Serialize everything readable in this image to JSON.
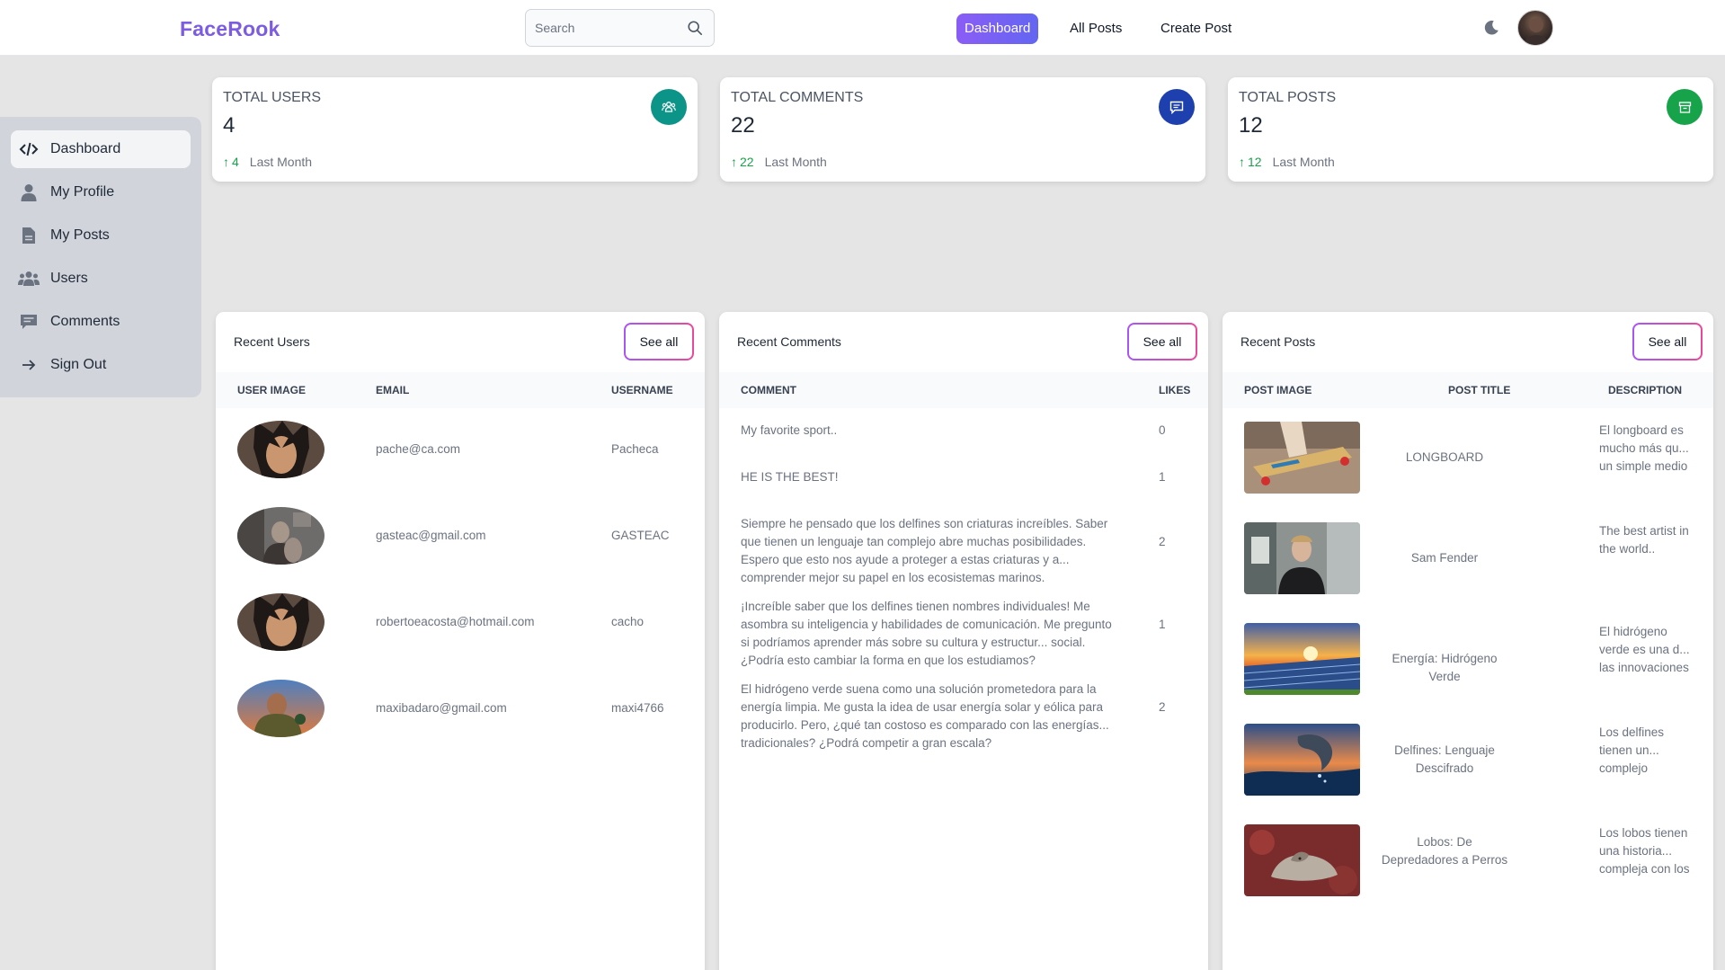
{
  "navbar": {
    "brand": "FaceRook",
    "search_placeholder": "Search",
    "links": [
      "Dashboard",
      "All Posts",
      "Create Post"
    ]
  },
  "sidebar": {
    "items": [
      {
        "label": "Dashboard",
        "icon": "code-icon",
        "active": true
      },
      {
        "label": "My Profile",
        "icon": "user-icon"
      },
      {
        "label": "My Posts",
        "icon": "document-icon"
      },
      {
        "label": "Users",
        "icon": "users-icon"
      },
      {
        "label": "Comments",
        "icon": "comment-icon"
      },
      {
        "label": "Sign Out",
        "icon": "arrow-right-icon"
      }
    ]
  },
  "stats": [
    {
      "title": "TOTAL USERS",
      "value": "4",
      "delta": "4",
      "period": "Last Month",
      "color": "#0d9488",
      "icon": "users-group-icon"
    },
    {
      "title": "TOTAL COMMENTS",
      "value": "22",
      "delta": "22",
      "period": "Last Month",
      "color": "#1e40af",
      "icon": "comment-icon"
    },
    {
      "title": "TOTAL POSTS",
      "value": "12",
      "delta": "12",
      "period": "Last Month",
      "color": "#16a34a",
      "icon": "archive-icon"
    }
  ],
  "recent_users": {
    "title": "Recent Users",
    "see_all": "See all",
    "headers": [
      "USER IMAGE",
      "EMAIL",
      "USERNAME"
    ],
    "rows": [
      {
        "email": "pache@ca.com",
        "username": "Pacheca"
      },
      {
        "email": "gasteac@gmail.com",
        "username": "GASTEAC"
      },
      {
        "email": "robertoeacosta@hotmail.com",
        "username": "cacho"
      },
      {
        "email": "maxibadaro@gmail.com",
        "username": "maxi4766"
      }
    ]
  },
  "recent_comments": {
    "title": "Recent Comments",
    "see_all": "See all",
    "headers": [
      "COMMENT",
      "LIKES"
    ],
    "rows": [
      {
        "comment": "My favorite sport..",
        "likes": "0"
      },
      {
        "comment": "HE IS THE BEST!",
        "likes": "1"
      },
      {
        "comment": "Siempre he pensado que los delfines son criaturas increíbles. Saber que tienen un lenguaje tan complejo abre muchas posibilidades. Espero que esto nos ayude a proteger a estas criaturas y a... comprender mejor su papel en los ecosistemas marinos.",
        "likes": "2"
      },
      {
        "comment": "¡Increíble saber que los delfines tienen nombres individuales! Me asombra su inteligencia y habilidades de comunicación. Me pregunto si podríamos aprender más sobre su cultura y estructur... social. ¿Podría esto cambiar la forma en que los estudiamos?",
        "likes": "1"
      },
      {
        "comment": "El hidrógeno verde suena como una solución prometedora para la energía limpia. Me gusta la idea de usar energía solar y eólica para producirlo. Pero, ¿qué tan costoso es comparado con las energías... tradicionales? ¿Podrá competir a gran escala?",
        "likes": "2"
      }
    ]
  },
  "recent_posts": {
    "title": "Recent Posts",
    "see_all": "See all",
    "headers": [
      "POST IMAGE",
      "POST TITLE",
      "DESCRIPTION"
    ],
    "rows": [
      {
        "title": "LONGBOARD",
        "description": "El longboard es mucho más qu... un simple medio"
      },
      {
        "title": "Sam Fender",
        "description": "The best artist in the world.."
      },
      {
        "title": "Energía: Hidrógeno Verde",
        "description": "El hidrógeno verde es una d... las innovaciones"
      },
      {
        "title": "Delfines: Lenguaje Descifrado",
        "description": "Los delfines tienen un... complejo"
      },
      {
        "title": "Lobos: De Depredadores a Perros",
        "description": "Los lobos tienen una historia... compleja con los"
      }
    ]
  }
}
